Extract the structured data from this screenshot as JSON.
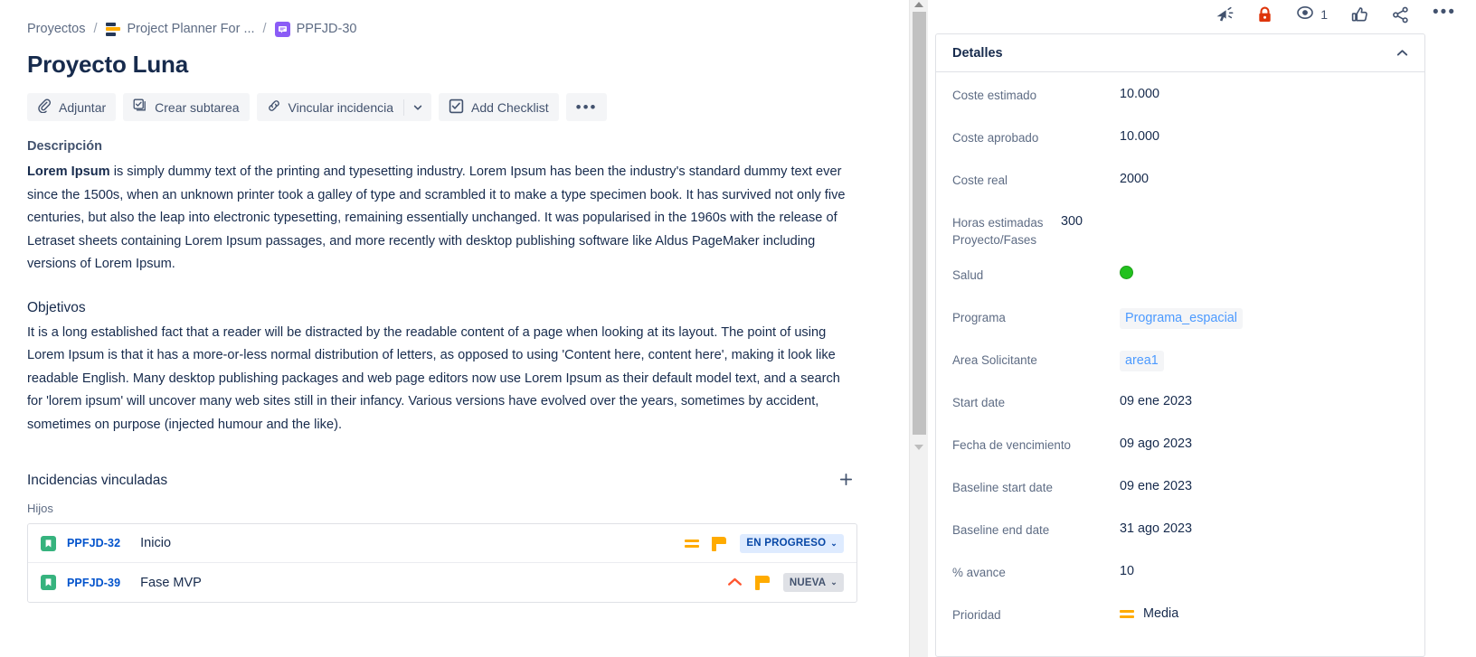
{
  "breadcrumb": {
    "root": "Proyectos",
    "separator": "/",
    "project": "Project Planner For ...",
    "issue_key": "PPFJD-30",
    "board_icon": "board-icon",
    "epic_icon": "epic-icon"
  },
  "page_title": "Proyecto Luna",
  "toolbar": {
    "attach_label": "Adjuntar",
    "subtask_label": "Crear subtarea",
    "link_label": "Vincular incidencia",
    "checklist_label": "Add Checklist",
    "more_label": "•••",
    "caret_icon": "chevron-down-icon"
  },
  "description": {
    "label": "Descripción",
    "bold_lead": "Lorem Ipsum",
    "text": " is simply dummy text of the printing and typesetting industry. Lorem Ipsum has been the industry's standard dummy text ever since the 1500s, when an unknown printer took a galley of type and scrambled it to make a type specimen book. It has survived not only five centuries, but also the leap into electronic typesetting, remaining essentially unchanged. It was popularised in the 1960s with the release of Letraset sheets containing Lorem Ipsum passages, and more recently with desktop publishing software like Aldus PageMaker including versions of Lorem Ipsum."
  },
  "objectives": {
    "heading": "Objetivos",
    "text": "It is a long established fact that a reader will be distracted by the readable content of a page when looking at its layout. The point of using Lorem Ipsum is that it has a more-or-less normal distribution of letters, as opposed to using 'Content here, content here', making it look like readable English. Many desktop publishing packages and web page editors now use Lorem Ipsum as their default model text, and a search for 'lorem ipsum' will uncover many web sites still in their infancy. Various versions have evolved over the years, sometimes by accident, sometimes on purpose (injected humour and the like)."
  },
  "linked_issues": {
    "heading": "Incidencias vinculadas",
    "add_icon": "plus-icon",
    "group_label": "Hijos",
    "rows": [
      {
        "type_icon": "story-icon",
        "key": "PPFJD-32",
        "summary": "Inicio",
        "priority_icon": "priority-medium-icon",
        "flag_icon": "flag-icon",
        "status": "EN PROGRESO",
        "status_style": "progress",
        "caret": "⌄"
      },
      {
        "type_icon": "story-icon",
        "key": "PPFJD-39",
        "summary": "Fase MVP",
        "priority_icon": "priority-high-icon",
        "flag_icon": "flag-icon",
        "status": "NUEVA",
        "status_style": "new",
        "caret": "⌄"
      }
    ]
  },
  "right_actions": {
    "announce_icon": "megaphone-icon",
    "lock_icon": "lock-icon",
    "watch_icon": "eye-icon",
    "watch_count": "1",
    "vote_icon": "thumbs-up-icon",
    "share_icon": "share-icon",
    "more_icon": "more-options-icon"
  },
  "details": {
    "title": "Detalles",
    "collapse_icon": "chevron-up-icon",
    "fields": [
      {
        "label": "Coste estimado",
        "value": "10.000",
        "kind": "text"
      },
      {
        "label": "Coste aprobado",
        "value": "10.000",
        "kind": "text"
      },
      {
        "label": "Coste real",
        "value": "2000",
        "kind": "text"
      },
      {
        "label": "Horas estimadas Proyecto/Fases",
        "value": "300",
        "kind": "text"
      },
      {
        "label": "Salud",
        "value": "",
        "kind": "health",
        "color": "#22C11E"
      },
      {
        "label": "Programa",
        "value": "Programa_espacial",
        "kind": "tag"
      },
      {
        "label": "Area Solicitante",
        "value": "area1",
        "kind": "tag"
      },
      {
        "label": "Start date",
        "value": "09 ene 2023",
        "kind": "text"
      },
      {
        "label": "Fecha de vencimiento",
        "value": "09 ago 2023",
        "kind": "text"
      },
      {
        "label": "Baseline start date",
        "value": "09 ene 2023",
        "kind": "text"
      },
      {
        "label": "Baseline end date",
        "value": "31 ago 2023",
        "kind": "text"
      },
      {
        "label": "% avance",
        "value": "10",
        "kind": "text"
      },
      {
        "label": "Prioridad",
        "value": "Media",
        "kind": "priority"
      }
    ]
  },
  "colors": {
    "link": "#0052CC",
    "tag_link": "#4C9AFF",
    "status_progress_bg": "#DEEBFF",
    "status_progress_fg": "#0747A6",
    "status_new_bg": "#DFE1E6",
    "lock_red": "#DE350B",
    "flag_yellow": "#FFAB00",
    "story_green": "#36B37E",
    "epic_purple": "#8B5CF6"
  }
}
